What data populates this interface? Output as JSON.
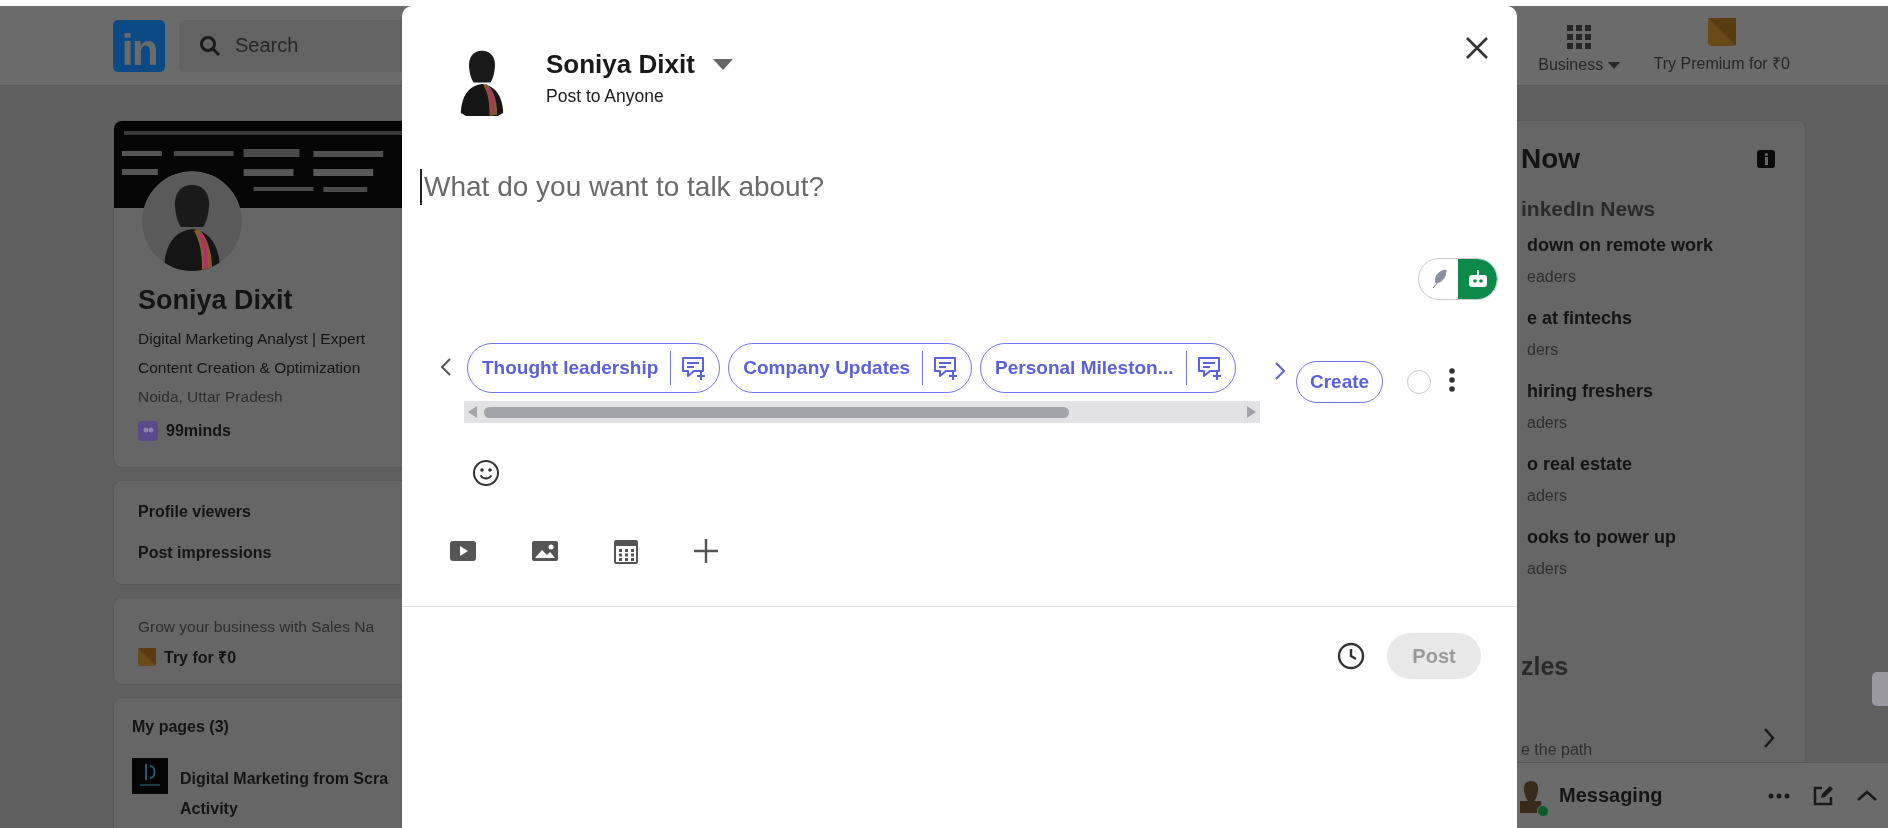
{
  "header": {
    "logo_text": "in",
    "search": {
      "placeholder": "Search"
    },
    "business": "Business",
    "premium": "Try Premium for ₹0"
  },
  "profile": {
    "name": "Soniya Dixit",
    "headline": [
      "Digital Marketing Analyst | Expert",
      "Content Creation & Optimization"
    ],
    "location": "Noida, Uttar Pradesh",
    "company": "99minds"
  },
  "stats": [
    "Profile viewers",
    "Post impressions"
  ],
  "promo": {
    "text": "Grow your business with Sales Na",
    "cta": "Try for ₹0"
  },
  "pages": {
    "title": "My pages (3)",
    "items": [
      {
        "name": "Digital Marketing from Scra",
        "sub": "Activity"
      }
    ]
  },
  "news": {
    "title": "Now",
    "subtitle": "inkedIn News",
    "items": [
      {
        "headline": "down on remote work",
        "meta": "eaders"
      },
      {
        "headline": "e at fintechs",
        "meta": "ders"
      },
      {
        "headline": "hiring freshers",
        "meta": "aders"
      },
      {
        "headline": "o real estate",
        "meta": "aders"
      },
      {
        "headline": "ooks to power up",
        "meta": "aders"
      }
    ],
    "section_title": "zles",
    "section_item": "e the path"
  },
  "messaging": {
    "label": "Messaging",
    "online": true
  },
  "composer": {
    "author": "Soniya Dixit",
    "audience": "Post to Anyone",
    "placeholder": "What do you want to talk about?",
    "chips": [
      {
        "label": "Thought leadership"
      },
      {
        "label": "Company Updates"
      },
      {
        "label": "Personal Mileston..."
      }
    ],
    "create_label": "Create",
    "post_label": "Post",
    "post_disabled": true
  }
}
